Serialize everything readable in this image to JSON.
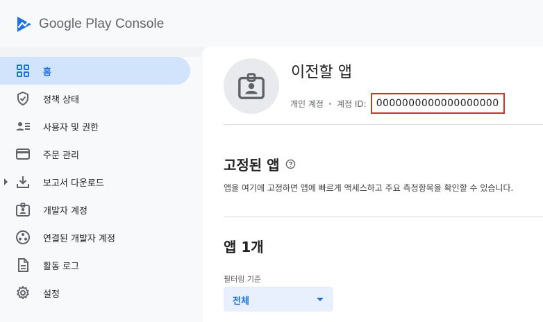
{
  "brand": {
    "name": "Google Play Console"
  },
  "sidebar": {
    "items": [
      {
        "label": "홈",
        "icon": "dashboard-grid-icon",
        "active": true
      },
      {
        "label": "정책 상태",
        "icon": "shield-check-icon"
      },
      {
        "label": "사용자 및 권한",
        "icon": "users-list-icon"
      },
      {
        "label": "주문 관리",
        "icon": "credit-card-icon"
      },
      {
        "label": "보고서 다운로드",
        "icon": "download-icon",
        "expandable": true
      },
      {
        "label": "개발자 계정",
        "icon": "badge-icon"
      },
      {
        "label": "연결된 개발자 계정",
        "icon": "linked-accounts-icon"
      },
      {
        "label": "활동 로그",
        "icon": "document-icon"
      },
      {
        "label": "설정",
        "icon": "gear-icon"
      }
    ]
  },
  "developer": {
    "name": "이전할 앱",
    "account_type": "개인 계정",
    "account_id_label": "계정 ID:",
    "account_id": "0000000000000000000"
  },
  "pinned": {
    "title": "고정된 앱",
    "description": "앱을 여기에 고정하면 앱에 빠르게 액세스하고 주요 측정항목을 확인할 수 있습니다."
  },
  "apps": {
    "title": "앱 1개",
    "filter_label": "필터링 기준",
    "filter_value": "전체"
  },
  "colors": {
    "accent": "#1a73e8",
    "active_bg": "#d2e3fc",
    "highlight": "#d93025"
  }
}
